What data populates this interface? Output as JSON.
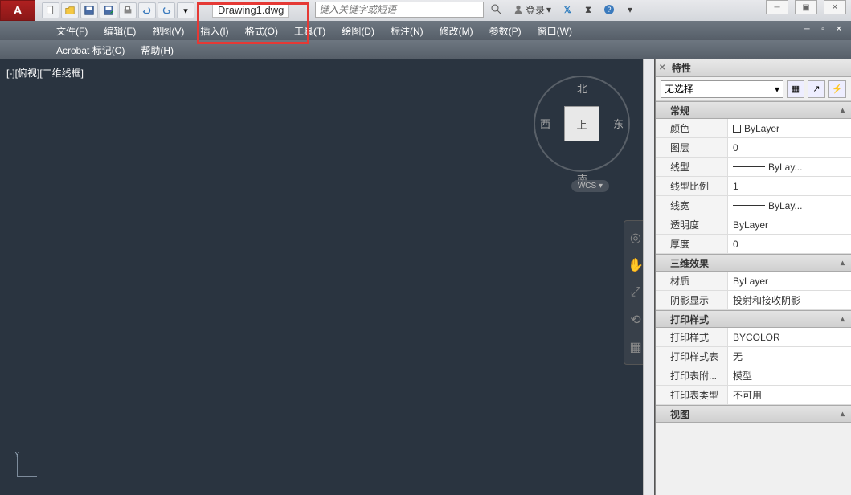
{
  "app_logo": "A",
  "filename": "Drawing1.dwg",
  "search_placeholder": "键入关键字或短语",
  "login_label": "登录",
  "menu": {
    "file": "文件(F)",
    "edit": "编辑(E)",
    "view": "视图(V)",
    "insert": "插入(I)",
    "format": "格式(O)",
    "tools": "工具(T)",
    "draw": "绘图(D)",
    "dim": "标注(N)",
    "modify": "修改(M)",
    "param": "参数(P)",
    "window": "窗口(W)",
    "acrobat": "Acrobat 标记(C)",
    "help": "帮助(H)"
  },
  "viewport_label": "[-][俯视][二维线框]",
  "viewcube": {
    "top": "上",
    "north": "北",
    "south": "南",
    "east": "东",
    "west": "西",
    "wcs": "WCS"
  },
  "panel": {
    "title": "特性",
    "selection": "无选择",
    "sections": {
      "general": "常规",
      "color": "颜色",
      "color_v": "ByLayer",
      "layer": "图层",
      "layer_v": "0",
      "linetype": "线型",
      "linetype_v": "ByLay...",
      "ltscale": "线型比例",
      "ltscale_v": "1",
      "lineweight": "线宽",
      "lineweight_v": "ByLay...",
      "transp": "透明度",
      "transp_v": "ByLayer",
      "thick": "厚度",
      "thick_v": "0",
      "three_d": "三维效果",
      "material": "材质",
      "material_v": "ByLayer",
      "shadow": "阴影显示",
      "shadow_v": "投射和接收阴影",
      "plot": "打印样式",
      "plot_style": "打印样式",
      "plot_style_v": "BYCOLOR",
      "plot_table": "打印样式表",
      "plot_table_v": "无",
      "plot_attach": "打印表附...",
      "plot_attach_v": "模型",
      "plot_type": "打印表类型",
      "plot_type_v": "不可用",
      "view": "视图"
    }
  }
}
